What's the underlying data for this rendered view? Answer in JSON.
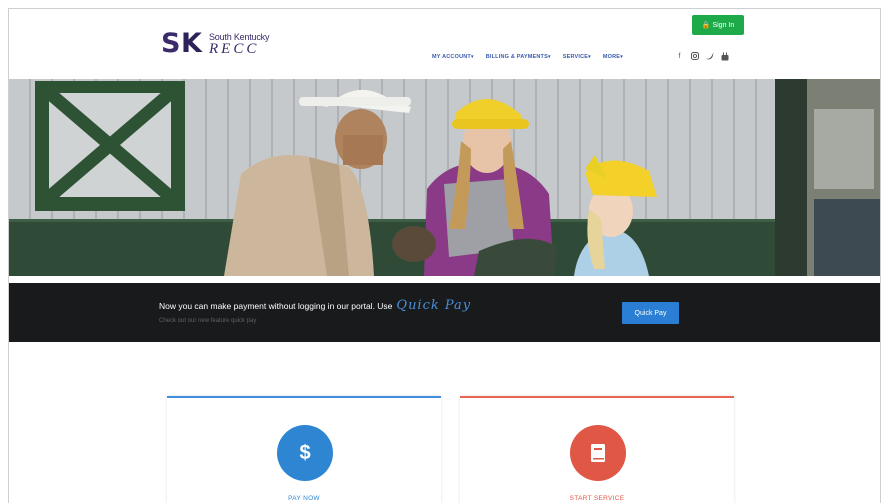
{
  "header": {
    "logo_mark": "SK",
    "logo_line1": "South Kentucky",
    "logo_line2": "RECC",
    "signin_label": "Sign In",
    "nav": [
      {
        "label": "MY ACCOUNT"
      },
      {
        "label": "BILLING & PAYMENTS"
      },
      {
        "label": "SERVICE"
      },
      {
        "label": "MORE"
      }
    ],
    "socials": [
      "facebook-icon",
      "instagram-icon",
      "twitter-icon",
      "youtube-icon"
    ]
  },
  "hero": {
    "image": "lineman-with-children-in-hard-hats-photo"
  },
  "banner": {
    "message": "Now you can make payment without logging in our portal. Use",
    "highlight": "Quick Pay",
    "sub": "Check out our new feature quick pay",
    "button_label": "Quick Pay"
  },
  "cards": {
    "pay": {
      "icon_glyph": "$",
      "label": "PAY NOW"
    },
    "start": {
      "label": "START SERVICE"
    }
  },
  "colors": {
    "brand_purple": "#3b2b6b",
    "signin_green": "#1faa4a",
    "nav_blue": "#3b5bb0",
    "quick_pay_blue": "#2a7fd4",
    "pay_blue": "#2e86d3",
    "start_red": "#e15745",
    "banner_bg": "#181a1c"
  }
}
